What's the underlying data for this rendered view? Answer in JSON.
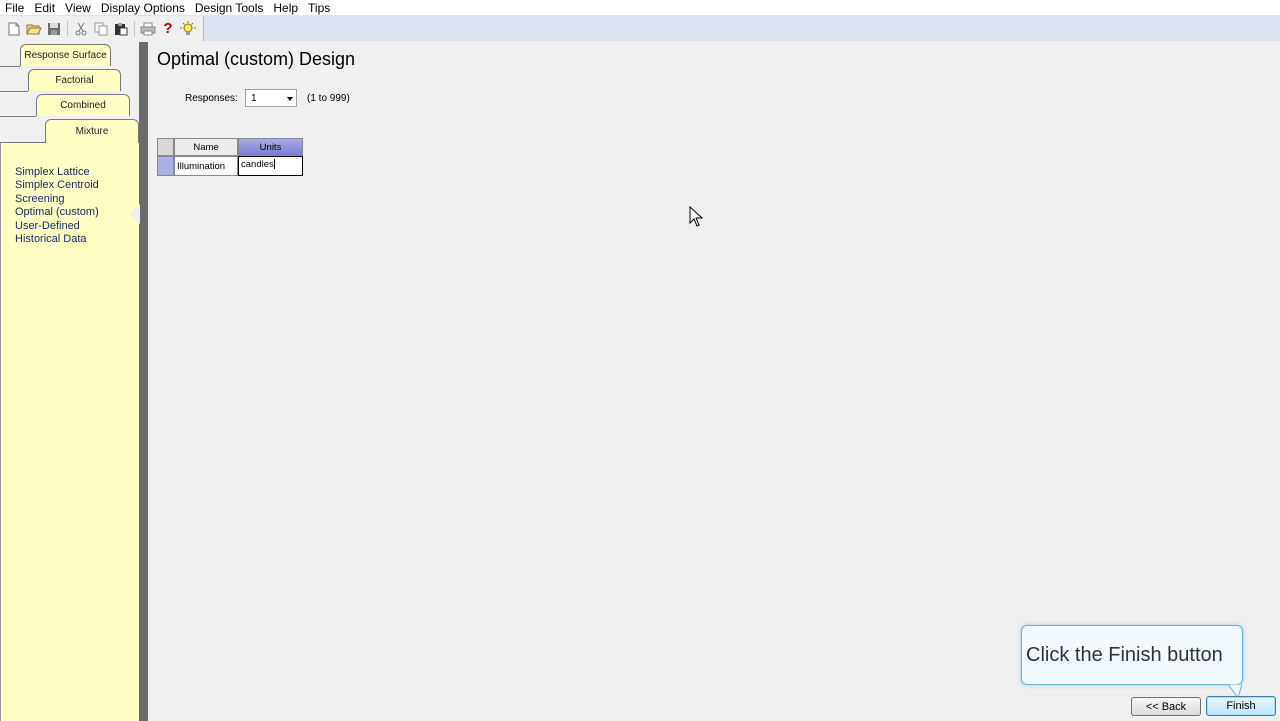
{
  "menu": [
    "File",
    "Edit",
    "View",
    "Display Options",
    "Design Tools",
    "Help",
    "Tips"
  ],
  "toolbar": {
    "icons": [
      "new-icon",
      "open-icon",
      "save-icon",
      "cut-icon",
      "copy-icon",
      "paste-icon",
      "print-icon",
      "help-icon",
      "tip-icon"
    ],
    "help_glyph": "?"
  },
  "tabs": {
    "response_surface": "Response Surface",
    "factorial": "Factorial",
    "combined": "Combined",
    "mixture": "Mixture"
  },
  "mixture_items": [
    "Simplex Lattice",
    "Simplex Centroid",
    "Screening",
    "Optimal (custom)",
    "User-Defined",
    "Historical Data"
  ],
  "main": {
    "title": "Optimal (custom) Design",
    "responses_label": "Responses:",
    "responses_value": "1",
    "responses_range": "(1 to 999)"
  },
  "grid": {
    "headers": [
      "Name",
      "Units"
    ],
    "rows": [
      {
        "name": "Illumination",
        "units": "candles"
      }
    ]
  },
  "tooltip": {
    "text": "Click the Finish button"
  },
  "buttons": {
    "back": "<< Back",
    "finish": "Finish"
  }
}
